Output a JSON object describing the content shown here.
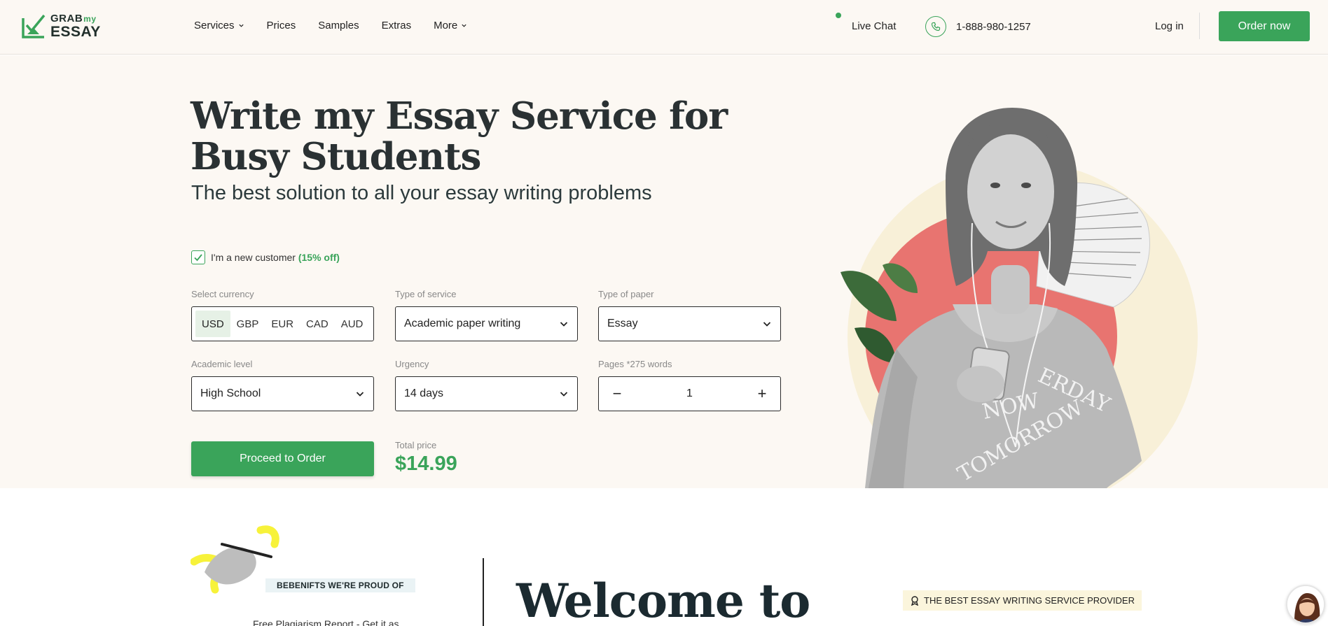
{
  "header": {
    "logo": {
      "line1": "GRAB",
      "line1_sup": "my",
      "line2": "ESSAY"
    },
    "nav": [
      {
        "label": "Services",
        "dropdown": true
      },
      {
        "label": "Prices",
        "dropdown": false
      },
      {
        "label": "Samples",
        "dropdown": false
      },
      {
        "label": "Extras",
        "dropdown": false
      },
      {
        "label": "More",
        "dropdown": true
      }
    ],
    "live_chat": "Live Chat",
    "phone": "1-888-980-1257",
    "login": "Log in",
    "order_now": "Order now"
  },
  "hero": {
    "title_line1": "Write my Essay Service for",
    "title_line2": "Busy Students",
    "subtitle": "The best solution to all your essay writing problems",
    "new_customer": {
      "label": "I'm a new customer",
      "discount": "(15% off)",
      "checked": true
    },
    "currency": {
      "label": "Select currency",
      "options": [
        "USD",
        "GBP",
        "EUR",
        "CAD",
        "AUD"
      ],
      "selected": "USD"
    },
    "service_type": {
      "label": "Type of service",
      "value": "Academic paper writing"
    },
    "paper_type": {
      "label": "Type of paper",
      "value": "Essay"
    },
    "academic_level": {
      "label": "Academic level",
      "value": "High School"
    },
    "urgency": {
      "label": "Urgency",
      "value": "14 days"
    },
    "pages": {
      "label": "Pages *275 words",
      "value": "1",
      "minus": "−",
      "plus": "+"
    },
    "proceed": "Proceed to Order",
    "total_label": "Total price",
    "total_value": "$14.99",
    "shirt_text": [
      "ERDAY",
      "NOW",
      "TOMORROW"
    ]
  },
  "below": {
    "benefits_tag": "BEBENIFTS WE'RE PROUD OF",
    "benefits_text": "Free Plagiarism Report - Get it as",
    "welcome": "Welcome to",
    "best_tag": "THE BEST ESSAY WRITING SERVICE PROVIDER"
  },
  "colors": {
    "accent": "#3aa45a",
    "hero_bg": "#fcf8f3",
    "text": "#1f2a2e"
  }
}
